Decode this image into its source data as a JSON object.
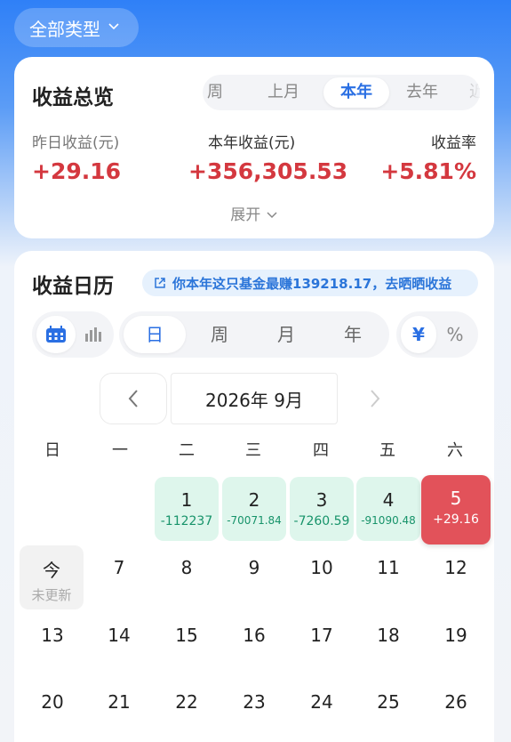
{
  "filter": {
    "label": "全部类型"
  },
  "overview": {
    "title": "收益总览",
    "tabs": [
      "周",
      "上月",
      "本年",
      "去年",
      "近"
    ],
    "active_tab": "本年",
    "stats": [
      {
        "label": "昨日收益(元)",
        "value": "+29.16"
      },
      {
        "label": "本年收益(元)",
        "value": "+356,305.53"
      },
      {
        "label": "收益率",
        "value": "+5.81%"
      }
    ],
    "expand_label": "展开"
  },
  "calendar": {
    "title": "收益日历",
    "banner": "你本年这只基金最赚139218.17，去晒晒收益",
    "granularity": [
      "日",
      "周",
      "月",
      "年"
    ],
    "active_granularity": "日",
    "unit_options": [
      "¥",
      "%"
    ],
    "active_unit": "¥",
    "month_label": "2026年 9月",
    "weekdays": [
      "日",
      "一",
      "二",
      "三",
      "四",
      "五",
      "六"
    ],
    "days": [
      {
        "day": "1",
        "value": "-112237"
      },
      {
        "day": "2",
        "value": "-70071.84"
      },
      {
        "day": "3",
        "value": "-7260.59"
      },
      {
        "day": "4",
        "value": "-91090.48"
      },
      {
        "day": "5",
        "value": "+29.16"
      },
      {
        "day": "今",
        "value": "未更新"
      },
      {
        "day": "7"
      },
      {
        "day": "8"
      },
      {
        "day": "9"
      },
      {
        "day": "10"
      },
      {
        "day": "11"
      },
      {
        "day": "12"
      },
      {
        "day": "13"
      },
      {
        "day": "14"
      },
      {
        "day": "15"
      },
      {
        "day": "16"
      },
      {
        "day": "17"
      },
      {
        "day": "18"
      },
      {
        "day": "19"
      },
      {
        "day": "20"
      },
      {
        "day": "21"
      },
      {
        "day": "22"
      },
      {
        "day": "23"
      },
      {
        "day": "24"
      },
      {
        "day": "25"
      },
      {
        "day": "26"
      }
    ]
  },
  "colors": {
    "accent": "#2a6fe3",
    "gain": "#d4383f",
    "loss_bg": "#def6ec",
    "loss_text": "#17936a"
  }
}
